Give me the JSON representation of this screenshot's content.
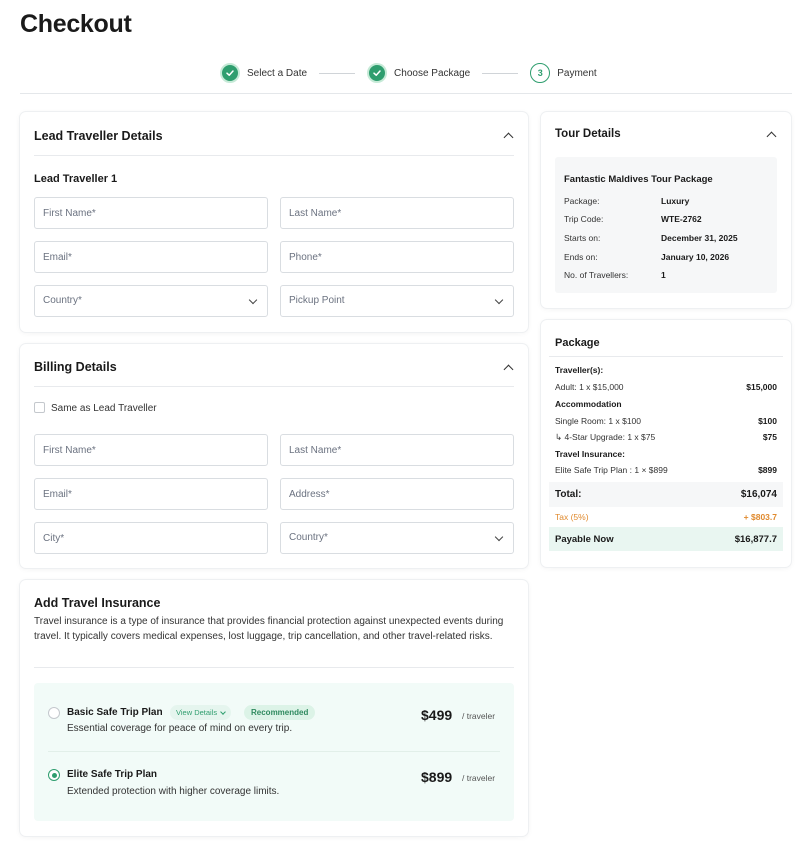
{
  "page": {
    "title": "Checkout"
  },
  "stepper": {
    "steps": [
      {
        "label": "Select a Date",
        "status": "done"
      },
      {
        "label": "Choose Package",
        "status": "done"
      },
      {
        "label": "Payment",
        "status": "current",
        "number": "3"
      }
    ]
  },
  "lead": {
    "title": "Lead Traveller Details",
    "subtitle": "Lead Traveller 1",
    "first_name": "First Name*",
    "last_name": "Last Name*",
    "email": "Email*",
    "phone": "Phone*",
    "country": "Country*",
    "pickup": "Pickup Point"
  },
  "billing": {
    "title": "Billing Details",
    "same_as_lead": "Same as Lead Traveller",
    "first_name": "First Name*",
    "last_name": "Last Name*",
    "email": "Email*",
    "address": "Address*",
    "city": "City*",
    "country": "Country*"
  },
  "insurance": {
    "title": "Add Travel Insurance",
    "description": "Travel insurance is a type of insurance that provides financial protection against unexpected events during travel. It typically covers medical expenses, lost luggage, trip cancellation, and other travel-related risks.",
    "plans": [
      {
        "name": "Basic Safe Trip Plan",
        "details_label": "View Details",
        "badge": "Recommended",
        "desc": "Essential coverage for peace of mind on every trip.",
        "price": "$499",
        "unit": "/ traveler",
        "selected": false
      },
      {
        "name": "Elite Safe Trip Plan",
        "desc": "Extended protection with higher coverage limits.",
        "price": "$899",
        "unit": "/ traveler",
        "selected": true
      }
    ]
  },
  "tour": {
    "title": "Tour Details",
    "name": "Fantastic Maldives Tour Package",
    "rows": [
      {
        "label": "Package:",
        "value": "Luxury"
      },
      {
        "label": "Trip Code:",
        "value": "WTE-2762"
      },
      {
        "label": "Starts on:",
        "value": "December 31, 2025"
      },
      {
        "label": "Ends on:",
        "value": "January 10, 2026"
      },
      {
        "label": "No. of Travellers:",
        "value": "1"
      }
    ]
  },
  "package": {
    "title": "Package",
    "travellers_heading": "Traveller(s):",
    "adult_label": "Adult: 1 x $15,000",
    "adult_amount": "$15,000",
    "accommodation_heading": "Accommodation",
    "single_room_label": "Single Room: 1 x $100",
    "single_room_amount": "$100",
    "upgrade_label": "↳ 4-Star Upgrade: 1 x $75",
    "upgrade_amount": "$75",
    "insurance_heading": "Travel Insurance:",
    "insurance_label": "Elite Safe Trip Plan : 1 × $899",
    "insurance_amount": "$899",
    "total_label": "Total:",
    "total_amount": "$16,074",
    "tax_label": "Tax (5%)",
    "tax_amount": "+ $803.7",
    "payable_label": "Payable Now",
    "payable_amount": "$16,877.7"
  },
  "colors": {
    "accent": "#2f9e6f",
    "tax": "#e08a2e",
    "payable_bg": "#e9f6f1"
  }
}
